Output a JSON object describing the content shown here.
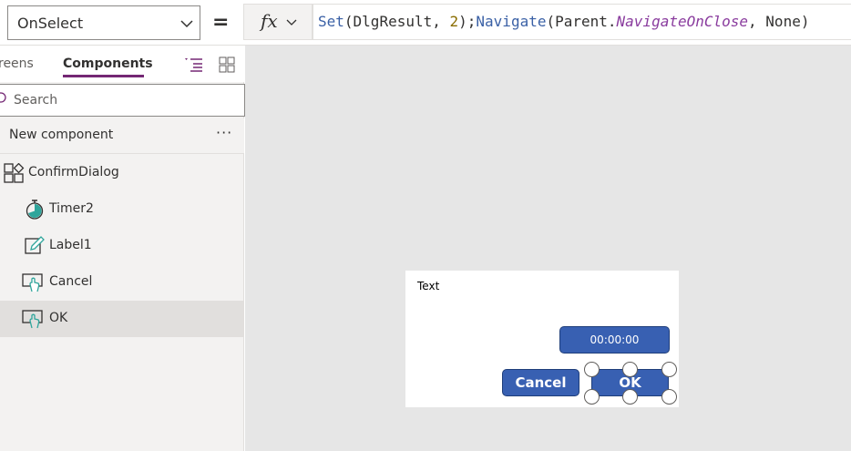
{
  "formula_bar": {
    "property": "OnSelect",
    "equals": "=",
    "fx_label": "fx",
    "formula_tokens": [
      {
        "text": "Set",
        "cls": "c-fn"
      },
      {
        "text": "(DlgResult, ",
        "cls": ""
      },
      {
        "text": "2",
        "cls": "c-num"
      },
      {
        "text": ");",
        "cls": ""
      },
      {
        "text": "Navigate",
        "cls": "c-fn"
      },
      {
        "text": "(Parent.",
        "cls": ""
      },
      {
        "text": "NavigateOnClose",
        "cls": "c-kw"
      },
      {
        "text": ", None)",
        "cls": ""
      }
    ]
  },
  "panel": {
    "tabs": {
      "screens": "reens",
      "components": "Components"
    },
    "search_placeholder": "Search",
    "new_component": "New component",
    "more": "···",
    "tree": [
      {
        "label": "ConfirmDialog",
        "icon": "component-icon",
        "selected": false
      },
      {
        "label": "Timer2",
        "icon": "timer-icon",
        "selected": false
      },
      {
        "label": "Label1",
        "icon": "label-edit-icon",
        "selected": false
      },
      {
        "label": "Cancel",
        "icon": "button-pointer-icon",
        "selected": false
      },
      {
        "label": "OK",
        "icon": "button-pointer-icon",
        "selected": true
      }
    ]
  },
  "canvas": {
    "dialog_text": "Text",
    "timer_value": "00:00:00",
    "cancel_label": "Cancel",
    "ok_label": "OK"
  },
  "colors": {
    "accent": "#742774",
    "button": "#3860b2",
    "canvas_bg": "#e6e6e6",
    "panel_bg": "#f3f2f1",
    "selected_bg": "#e1dfdd"
  }
}
